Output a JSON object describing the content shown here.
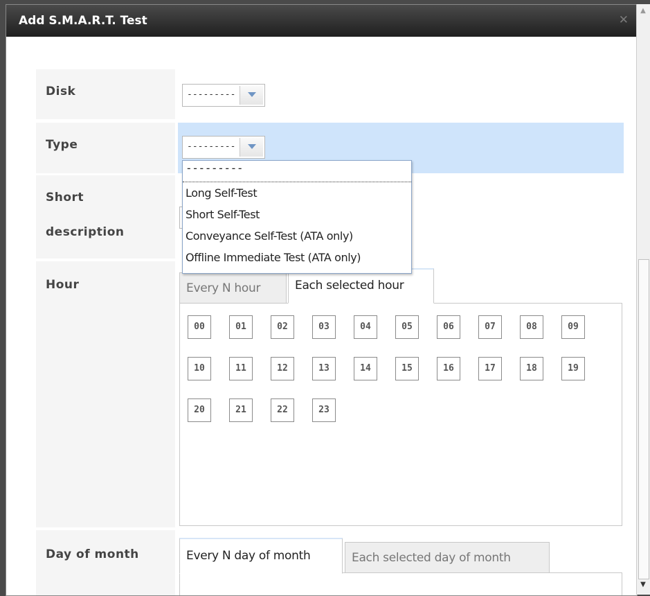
{
  "dialog": {
    "title": "Add S.M.A.R.T. Test",
    "close_icon": "close-icon"
  },
  "fields": {
    "disk": {
      "label": "Disk",
      "value": "---------"
    },
    "type": {
      "label": "Type",
      "value": "---------"
    },
    "short_description": {
      "label_line1": "Short",
      "label_line2": "description"
    },
    "hour": {
      "label": "Hour"
    },
    "day_of_month": {
      "label": "Day of month"
    }
  },
  "type_dropdown": {
    "options": [
      "---------",
      "Long Self-Test",
      "Short Self-Test",
      "Conveyance Self-Test (ATA only)",
      "Offline Immediate Test (ATA only)"
    ]
  },
  "hour_tabs": {
    "every_n": "Every N hour",
    "each_selected": "Each selected hour",
    "active": "each_selected"
  },
  "hours": [
    "00",
    "01",
    "02",
    "03",
    "04",
    "05",
    "06",
    "07",
    "08",
    "09",
    "10",
    "11",
    "12",
    "13",
    "14",
    "15",
    "16",
    "17",
    "18",
    "19",
    "20",
    "21",
    "22",
    "23"
  ],
  "dom_tabs": {
    "every_n": "Every N day of month",
    "each_selected": "Each selected day of month",
    "active": "every_n"
  }
}
